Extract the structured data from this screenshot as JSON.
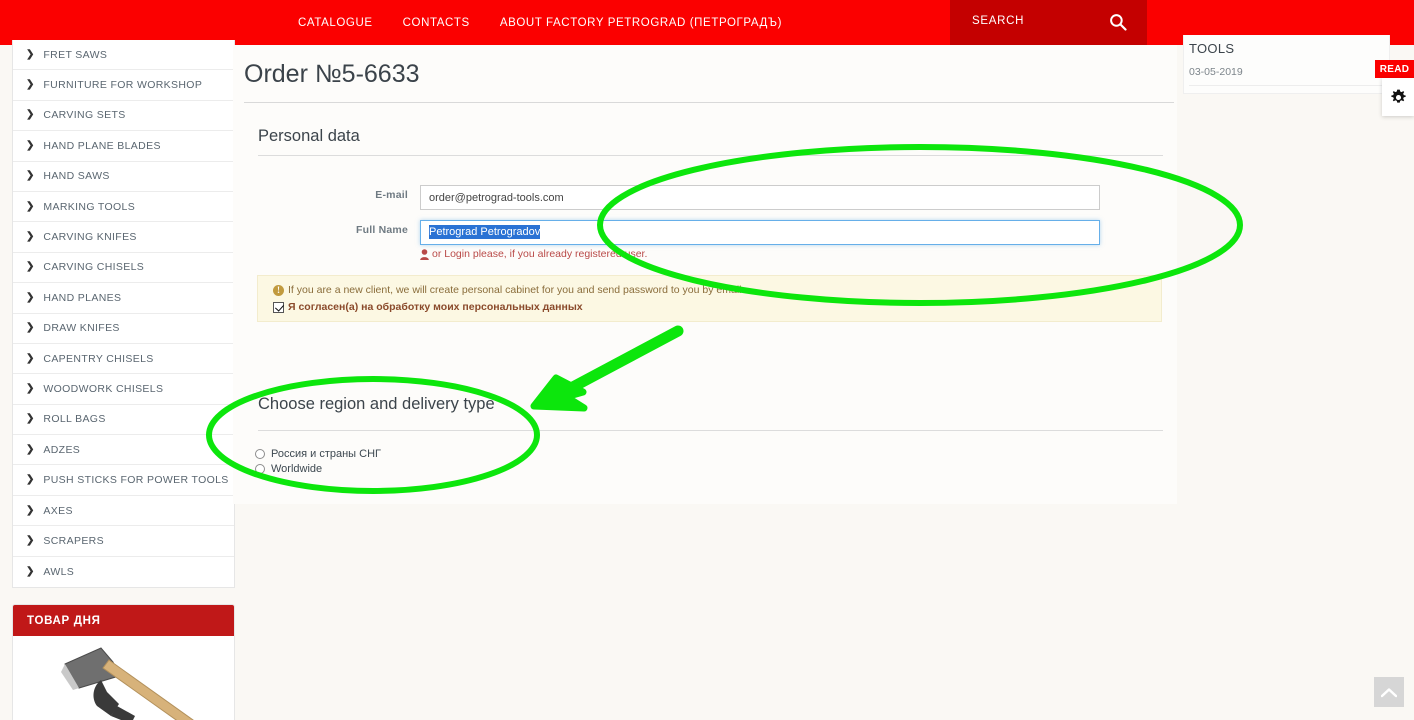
{
  "header": {
    "nav": [
      {
        "label": "CATALOGUE"
      },
      {
        "label": "CONTACTS"
      },
      {
        "label": "ABOUT FACTORY PETROGRAD (ПЕТРОГРАДЪ)"
      }
    ],
    "search": {
      "label": "SEARCH",
      "icon": "search-icon"
    },
    "bar_color": "#fb0000",
    "search_bg": "#c40000"
  },
  "sidebar": {
    "items": [
      {
        "label": "FRET SAWS"
      },
      {
        "label": "FURNITURE FOR WORKSHOP"
      },
      {
        "label": "CARVING SETS"
      },
      {
        "label": "HAND PLANE BLADES"
      },
      {
        "label": "HAND SAWS"
      },
      {
        "label": "MARKING TOOLS"
      },
      {
        "label": "CARVING KNIFES"
      },
      {
        "label": "CARVING CHISELS"
      },
      {
        "label": "HAND PLANES"
      },
      {
        "label": "DRAW KNIFES"
      },
      {
        "label": "CAPENTRY CHISELS"
      },
      {
        "label": "WOODWORK CHISELS"
      },
      {
        "label": "ROLL BAGS"
      },
      {
        "label": "ADZES"
      },
      {
        "label": "PUSH STICKS FOR POWER TOOLS"
      },
      {
        "label": "AXES"
      },
      {
        "label": "SCRAPERS"
      },
      {
        "label": "AWLS"
      }
    ],
    "chevron_icon": "chevron-right-icon"
  },
  "product_of_day": {
    "title": "ТОВАР ДНЯ",
    "header_color": "#c01818",
    "image_alt": "axe-product-image"
  },
  "main": {
    "order_title": "Order №5-6633",
    "personal_data": {
      "section_title": "Personal data",
      "fields": [
        {
          "label": "E-mail",
          "value": "order@petrograd-tools.com",
          "placeholder": "E-mail",
          "focused": false,
          "selected": false
        },
        {
          "label": "Full Name",
          "value": "Petrograd Petrogradov",
          "placeholder": "Full Name",
          "focused": true,
          "selected": true
        }
      ],
      "login_hint_icon": "user-icon",
      "login_hint_text": "or Login please, if you already registered user.",
      "login_link_text": "Login"
    },
    "alert": {
      "info_icon": "info-icon",
      "line1": "If you are a new client, we will create personal cabinet for you and send password to you by email",
      "checkbox_icon": "checkbox-checked-icon",
      "checkbox_checked": true,
      "line2": "Я согласен(а) на обработку моих персональных данных",
      "bg_color": "#fcf8e3"
    },
    "delivery": {
      "section_title": "Choose region and delivery type",
      "options": [
        {
          "label": "Россия и страны СНГ",
          "selected": false
        },
        {
          "label": "Worldwide",
          "selected": false
        }
      ]
    }
  },
  "right_rail": {
    "title": "TOOLS",
    "date": "03-05-2019",
    "read_badge": "READ",
    "gear_icon": "gear-icon"
  },
  "scroll_top": {
    "icon": "chevron-up-icon"
  },
  "annotations": {
    "color": "#0ce60c",
    "shapes": [
      {
        "type": "ellipse",
        "name": "highlight-personal-data-fields"
      },
      {
        "type": "ellipse",
        "name": "highlight-delivery-section"
      },
      {
        "type": "arrow",
        "name": "arrow-to-delivery-section"
      }
    ]
  }
}
